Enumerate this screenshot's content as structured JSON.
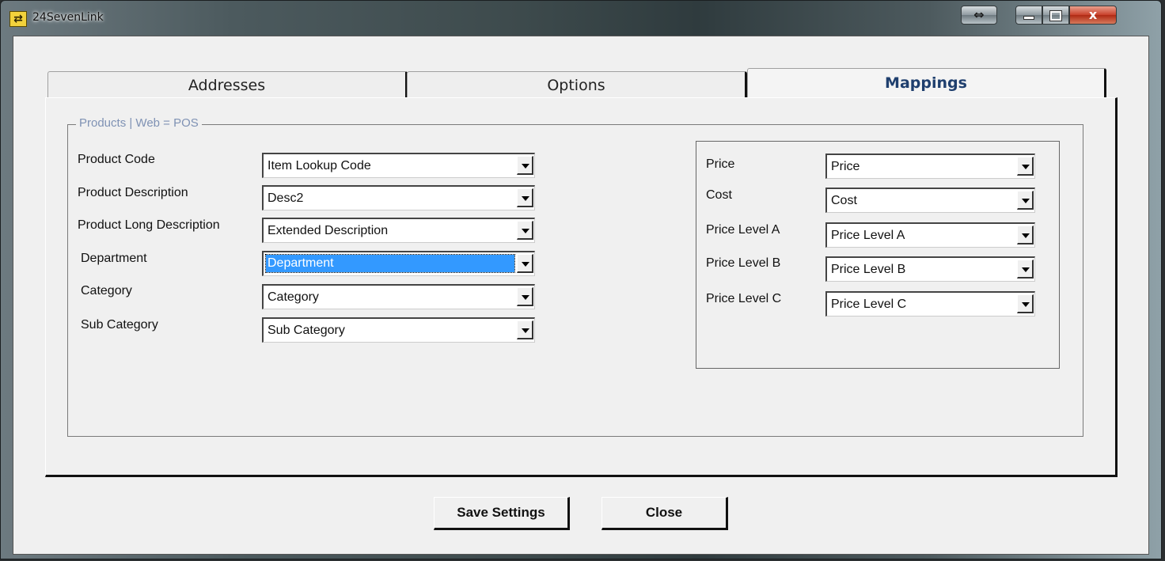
{
  "window": {
    "title": "24SevenLink",
    "icon": "app-link-icon",
    "controls": [
      "resize-icon",
      "minimize-icon",
      "maximize-icon",
      "close-icon"
    ],
    "close_glyph": "x",
    "resize_glyph": "⇔"
  },
  "tabs": [
    {
      "label": "Addresses",
      "active": false
    },
    {
      "label": "Options",
      "active": false
    },
    {
      "label": "Mappings",
      "active": true
    }
  ],
  "group": {
    "legend": "Products | Web = POS",
    "left_fields": [
      {
        "label": "Product Code",
        "value": "Item Lookup Code"
      },
      {
        "label": "Product Description",
        "value": "Desc2"
      },
      {
        "label": "Product Long Description",
        "value": "Extended Description"
      },
      {
        "label": "Department",
        "value": "Department",
        "selected": true
      },
      {
        "label": "Category",
        "value": "Category"
      },
      {
        "label": "Sub Category",
        "value": "Sub Category"
      }
    ],
    "right_fields": [
      {
        "label": "Price",
        "value": "Price"
      },
      {
        "label": "Cost",
        "value": "Cost"
      },
      {
        "label": "Price Level A",
        "value": "Price Level A"
      },
      {
        "label": "Price Level B",
        "value": "Price Level B"
      },
      {
        "label": "Price Level C",
        "value": "Price Level C"
      }
    ]
  },
  "buttons": {
    "save": "Save Settings",
    "close": "Close"
  },
  "colors": {
    "selection": "#3399ff",
    "active_tab_text": "#1f3f6e",
    "legend_text": "#7f92b4"
  }
}
